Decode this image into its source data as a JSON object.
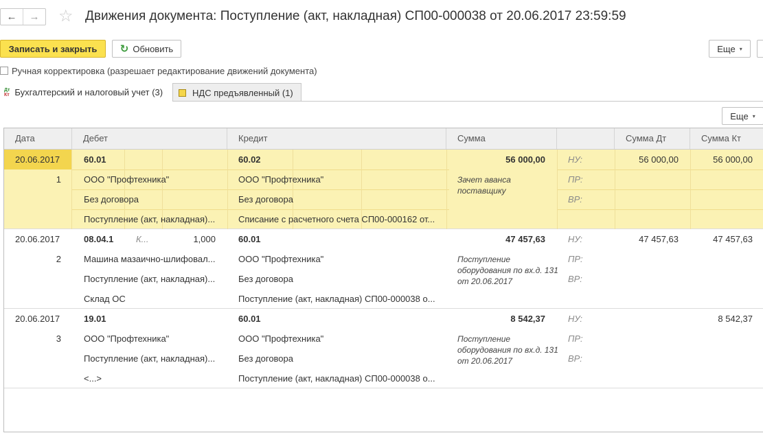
{
  "window": {
    "title": "Движения документа: Поступление (акт, накладная) СП00-000038 от 20.06.2017 23:59:59",
    "nav_back": "←",
    "nav_forward": "→",
    "favorite_star": "☆"
  },
  "toolbar": {
    "save_close": "Записать и закрыть",
    "refresh": "Обновить",
    "refresh_icon": "↻",
    "more": "Еще",
    "more_caret": "▾"
  },
  "manual_correction": {
    "label": "Ручная корректировка (разрешает редактирование движений документа)",
    "checked": false
  },
  "tabs": [
    {
      "icon": "dt-kt-icon",
      "icon_top": "Дт",
      "icon_bottom": "Кт",
      "label": "Бухгалтерский и налоговый учет (3)",
      "active": true
    },
    {
      "icon": "vat-register-icon",
      "label": "НДС предъявленный (1)",
      "active": false
    }
  ],
  "table_toolbar": {
    "more": "Еще",
    "more_caret": "▾"
  },
  "table": {
    "columns": [
      "Дата",
      "Дебет",
      "Кредит",
      "Сумма",
      "",
      "Сумма Дт",
      "Сумма Кт"
    ],
    "rows": [
      {
        "date": "20.06.2017",
        "num": "1",
        "debit": [
          "60.01",
          "ООО \"Профтехника\"",
          "Без договора",
          "Поступление (акт, накладная)..."
        ],
        "debit_qty_label": "",
        "debit_qty": "",
        "credit": [
          "60.02",
          "ООО \"Профтехника\"",
          "Без договора",
          "Списание с расчетного счета СП00-000162 от..."
        ],
        "sum": "56 000,00",
        "comment": "Зачет аванса поставщику",
        "tax_labels": [
          "НУ:",
          "ПР:",
          "ВР:"
        ],
        "sum_dt": "56 000,00",
        "sum_kt": "56 000,00",
        "selected": true
      },
      {
        "date": "20.06.2017",
        "num": "2",
        "debit": [
          "08.04.1",
          "Машина мазаично-шлифовал...",
          "Поступление (акт, накладная)...",
          "Склад ОС"
        ],
        "debit_qty_label": "К...",
        "debit_qty": "1,000",
        "credit": [
          "60.01",
          "ООО \"Профтехника\"",
          "Без договора",
          "Поступление (акт, накладная) СП00-000038 о..."
        ],
        "sum": "47 457,63",
        "comment": "Поступление оборудования по вх.д. 131 от 20.06.2017",
        "tax_labels": [
          "НУ:",
          "ПР:",
          "ВР:"
        ],
        "sum_dt": "47 457,63",
        "sum_kt": "47 457,63",
        "selected": false
      },
      {
        "date": "20.06.2017",
        "num": "3",
        "debit": [
          "19.01",
          "ООО \"Профтехника\"",
          "Поступление (акт, накладная)...",
          "<...>"
        ],
        "debit_qty_label": "",
        "debit_qty": "",
        "credit": [
          "60.01",
          "ООО \"Профтехника\"",
          "Без договора",
          "Поступление (акт, накладная) СП00-000038 о..."
        ],
        "sum": "8 542,37",
        "comment": "Поступление оборудования по вх.д. 131 от 20.06.2017",
        "tax_labels": [
          "НУ:",
          "ПР:",
          "ВР:"
        ],
        "sum_dt": "",
        "sum_kt": "8 542,37",
        "selected": false
      }
    ]
  },
  "colors": {
    "accent_yellow": "#fbe14f",
    "selected_row": "#fbf2b4",
    "selected_date": "#f3d54e"
  }
}
